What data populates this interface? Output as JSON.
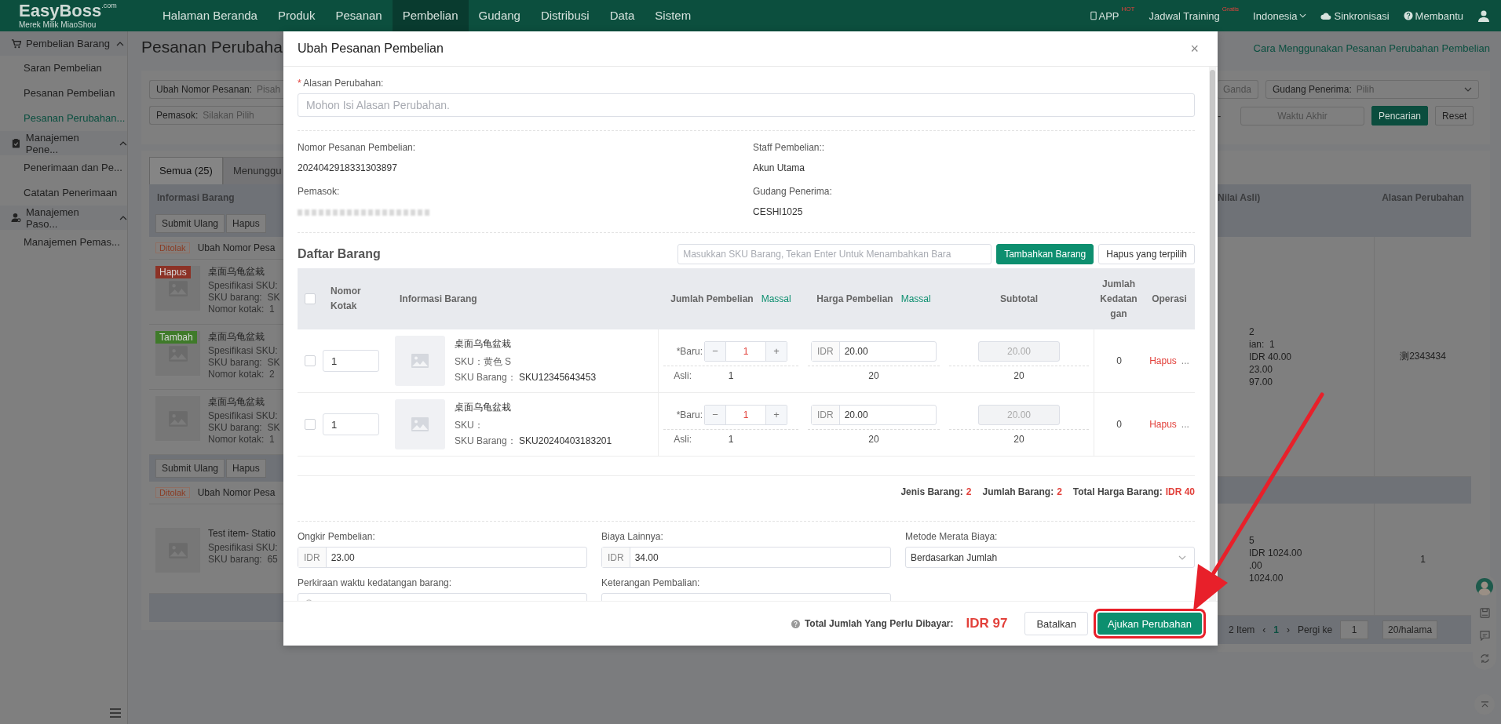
{
  "nav": {
    "logo": "EasyBoss",
    "logo_suffix": ".com",
    "logo_tagline": "Merek Milik MiaoShou",
    "items": [
      {
        "label": "Halaman Beranda",
        "selected": false
      },
      {
        "label": "Produk",
        "selected": false
      },
      {
        "label": "Pesanan",
        "selected": false
      },
      {
        "label": "Pembelian",
        "selected": true
      },
      {
        "label": "Gudang",
        "selected": false
      },
      {
        "label": "Distribusi",
        "selected": false
      },
      {
        "label": "Data",
        "selected": false
      },
      {
        "label": "Sistem",
        "selected": false
      }
    ],
    "tools": [
      {
        "kind": "app",
        "label": "APP",
        "badge": "HOT"
      },
      {
        "kind": "training",
        "label": "Jadwal Training",
        "badge": "Gratis"
      },
      {
        "kind": "language",
        "label": "Indonesia"
      },
      {
        "kind": "sync",
        "label": "Sinkronisasi"
      },
      {
        "kind": "help",
        "label": "Membantu"
      },
      {
        "kind": "user"
      }
    ]
  },
  "sidebar": {
    "groups": [
      {
        "kind": "cart",
        "label": "Pembelian Barang",
        "expanded": true,
        "children": [
          {
            "label": "Saran Pembelian",
            "selected": false
          },
          {
            "label": "Pesanan Pembelian",
            "selected": false
          },
          {
            "label": "Pesanan Perubahan...",
            "selected": true
          }
        ]
      },
      {
        "kind": "clipboard",
        "label": "Manajemen Pene...",
        "expanded": true,
        "children": [
          {
            "label": "Penerimaan dan Pe...",
            "selected": false
          },
          {
            "label": "Catatan Penerimaan",
            "selected": false
          }
        ]
      },
      {
        "kind": "supplier",
        "label": "Manajemen Paso...",
        "expanded": true,
        "children": [
          {
            "label": "Manajemen Pemas...",
            "selected": false
          }
        ]
      }
    ]
  },
  "page": {
    "title": "Pesanan Perubaha",
    "help_link": "Cara Menggunakan Pesanan Perubahan Pembelian",
    "filters": [
      {
        "label": "Ubah Nomor Pesanan:",
        "placeholder": "Pisah"
      },
      {
        "label": "Pemasok:",
        "placeholder": "Silakan Pilih"
      }
    ],
    "duplicate_tail": "Ganda",
    "warehouse_filter": {
      "label": "Gudang Penerima:",
      "placeholder": "Pilih"
    },
    "range_dash": "-",
    "end_time_placeholder": "Waktu Akhir",
    "search_button": "Pencarian",
    "reset_button": "Reset",
    "tabs": [
      {
        "label": "Semua (25)",
        "selected": true
      },
      {
        "label": "Menunggu",
        "selected": false
      }
    ],
    "columns": [
      "Informasi Barang",
      "Nilai Asli)",
      "Alasan Perubahan"
    ],
    "groups": [
      {
        "actions": [
          "Submit Ulang",
          "Hapus"
        ],
        "status": "Ditolak",
        "order": "Ubah Nomor Pesa",
        "values": [
          "2",
          "ian:  1",
          "IDR 40.00",
          "23.00",
          "97.00"
        ],
        "reason": "测2343434",
        "items": [
          {
            "tag": {
              "kind": "remove",
              "label": "Hapus"
            },
            "name": "桌面乌龟盆栽",
            "lines": [
              "Spesifikasi SKU:",
              "SKU barang:  SK",
              "Nomor kotak:  1"
            ]
          },
          {
            "tag": {
              "kind": "add",
              "label": "Tambah"
            },
            "name": "桌面乌龟盆栽",
            "lines": [
              "Spesifikasi SKU:",
              "SKU barang:  SK",
              "Nomor kotak:  2"
            ]
          },
          {
            "name": "桌面乌龟盆栽",
            "lines": [
              "Spesifikasi SKU:",
              "SKU barang:  SK",
              "Nomor kotak:  1"
            ]
          }
        ]
      },
      {
        "actions": [
          "Submit Ulang",
          "Hapus"
        ],
        "status": "Ditolak",
        "order": "Ubah Nomor Pesa",
        "values": [
          "5",
          "IDR 1024.00",
          ".00",
          "1024.00"
        ],
        "reason": "1",
        "items": [
          {
            "name": "Test item- Statio",
            "lines": [
              "Spesifikasi SKU:",
              "SKU barang:  65"
            ]
          }
        ]
      }
    ],
    "pagination": {
      "total": "2 Item",
      "prev": "‹",
      "pages": [
        {
          "label": "1",
          "selected": true
        }
      ],
      "next": "›",
      "goto_label": "Pergi ke",
      "goto_value": "1",
      "page_size": "20/halama"
    }
  },
  "modal": {
    "title": "Ubah Pesanan Pembelian",
    "close": "×",
    "reason": {
      "label": "Alasan Perubahan:",
      "required_mark": "*",
      "placeholder": "Mohon Isi Alasan Perubahan."
    },
    "stepper_minus": "−",
    "stepper_plus": "+",
    "info": [
      {
        "label": "Nomor Pesanan Pembelian:",
        "value": "2024042918331303897",
        "redacted": false
      },
      {
        "label": "Staff Pembelian::",
        "value": "Akun Utama",
        "redacted": false
      },
      {
        "label": "Pemasok:",
        "redacted": true
      },
      {
        "label": "Gudang Penerima:",
        "value": "CESHI1025",
        "redacted": false
      }
    ],
    "list_title": "Daftar Barang",
    "search_placeholder": "Masukkan SKU Barang, Tekan Enter Untuk Menambahkan Bara",
    "add_button": "Tambahkan Barang",
    "remove_button": "Hapus yang terpilih",
    "select_all_checked": false,
    "columns": [
      {
        "label": "Nomor Kotak"
      },
      {
        "label": "Informasi Barang"
      },
      {
        "label": "Jumlah Pembelian",
        "link": "Massal"
      },
      {
        "label": "Harga Pembelian",
        "link": "Massal"
      },
      {
        "label": "Subtotal"
      },
      {
        "label": "Jumlah Kedatangan"
      },
      {
        "label": "Operasi"
      }
    ],
    "rows": [
      {
        "checked": false,
        "box_no": "1",
        "name": "桌面乌龟盆栽",
        "sku": "SKU：黄色 S",
        "sku_code_label": "SKU Barang：",
        "sku_code": "SKU12345643453",
        "new_label": "*Baru:",
        "qty": "1",
        "original_label": "Asli:",
        "original_qty": "1",
        "currency": "IDR",
        "price": "20.00",
        "original_price": "20",
        "subtotal": "20.00",
        "subtotal_disabled": true,
        "original_subtotal": "20",
        "arrived": "0",
        "action": "Hapus",
        "more": "..."
      },
      {
        "checked": false,
        "box_no": "1",
        "name": "桌面乌龟盆栽",
        "sku": "SKU：",
        "sku_code_label": "SKU Barang：",
        "sku_code": "SKU20240403183201",
        "new_label": "*Baru:",
        "qty": "1",
        "original_label": "Asli:",
        "original_qty": "1",
        "currency": "IDR",
        "price": "20.00",
        "original_price": "20",
        "subtotal": "20.00",
        "subtotal_disabled": true,
        "original_subtotal": "20",
        "arrived": "0",
        "action": "Hapus",
        "more": "..."
      }
    ],
    "totals": [
      {
        "label": "Jenis Barang:",
        "value": "2"
      },
      {
        "label": "Jumlah Barang:",
        "value": "2"
      },
      {
        "label": "Total Harga Barang:",
        "value": "IDR 40"
      }
    ],
    "costs": [
      {
        "kind": "money",
        "label": "Ongkir Pembelian:",
        "currency": "IDR",
        "value": "23.00"
      },
      {
        "kind": "money",
        "label": "Biaya Lainnya:",
        "currency": "IDR",
        "value": "34.00"
      },
      {
        "kind": "select",
        "label": "Metode Merata Biaya:",
        "value": "Berdasarkan Jumlah"
      },
      {
        "kind": "date",
        "label": "Perkiraan waktu kedatangan barang:"
      },
      {
        "kind": "text",
        "label": "Keterangan Pembalian:"
      }
    ],
    "footer": {
      "total_label": "Total Jumlah Yang Perlu Dibayar:",
      "total_value": "IDR 97",
      "cancel": "Batalkan",
      "submit": "Ajukan Perubahan"
    }
  }
}
